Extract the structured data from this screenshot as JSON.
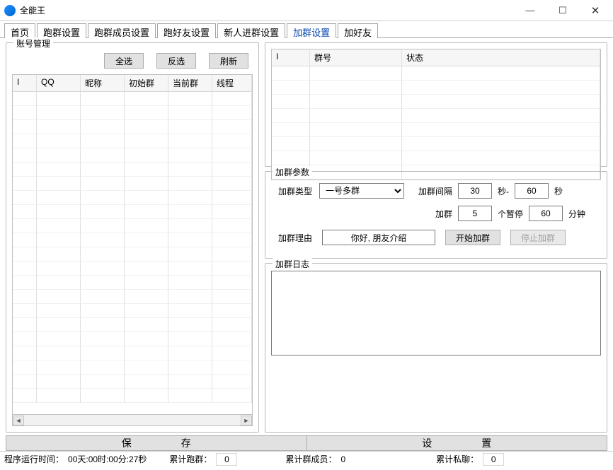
{
  "window": {
    "title": "全能王"
  },
  "win_controls": {
    "min": "—",
    "max": "☐",
    "close": "✕"
  },
  "tabs": [
    {
      "label": "首页"
    },
    {
      "label": "跑群设置"
    },
    {
      "label": "跑群成员设置"
    },
    {
      "label": "跑好友设置"
    },
    {
      "label": "新人进群设置"
    },
    {
      "label": "加群设置"
    },
    {
      "label": "加好友"
    }
  ],
  "active_tab_index": 5,
  "account_panel": {
    "title": "账号管理",
    "buttons": {
      "select_all": "全选",
      "invert": "反选",
      "refresh": "刷新"
    },
    "columns": [
      "I",
      "QQ",
      "昵称",
      "初始群",
      "当前群",
      "线程"
    ]
  },
  "group_table": {
    "columns": [
      "I",
      "群号",
      "状态"
    ]
  },
  "params_panel": {
    "title": "加群参数",
    "type_label": "加群类型",
    "type_options": [
      "一号多群"
    ],
    "type_value": "一号多群",
    "interval_label": "加群间隔",
    "interval_min": "30",
    "interval_unit1": "秒-",
    "interval_max": "60",
    "interval_unit2": "秒",
    "pause_label": "加群",
    "pause_count": "5",
    "pause_count_unit": "个暂停",
    "pause_duration": "60",
    "pause_duration_unit": "分钟",
    "reason_label": "加群理由",
    "reason_value": "你好, 朋友介绍",
    "start_btn": "开始加群",
    "stop_btn": "停止加群"
  },
  "log_panel": {
    "title": "加群日志",
    "content": ""
  },
  "big_buttons": {
    "save": "保　　　　　存",
    "set": "设　　　　　置"
  },
  "status": {
    "runtime_label": "程序运行时间：",
    "runtime_value": "00天:00时:00分:27秒",
    "run_group_label": "累计跑群：",
    "run_group_value": "0",
    "member_label": "累计群成员：",
    "member_value": "0",
    "private_label": "累计私聊：",
    "private_value": "0"
  }
}
